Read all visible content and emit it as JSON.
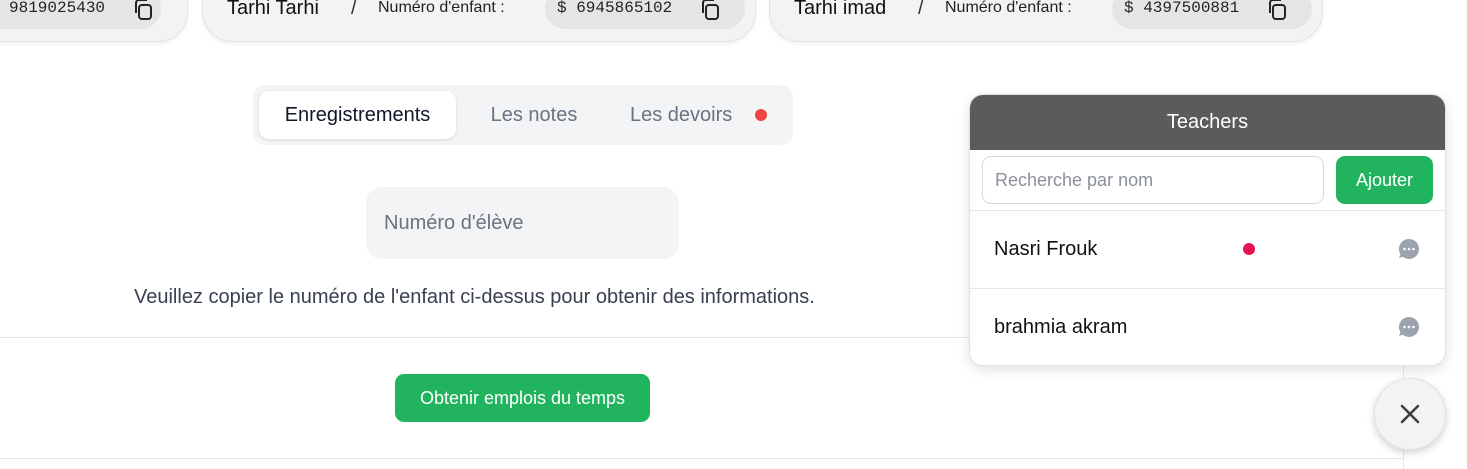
{
  "children": [
    {
      "name": "",
      "slash": "",
      "number_label": "",
      "number": "9819025430"
    },
    {
      "name": "Tarhi  Tarhi",
      "slash": "/",
      "number_label": "Numéro d'enfant :",
      "number": "$ 6945865102"
    },
    {
      "name": "Tarhi  imad",
      "slash": "/",
      "number_label": "Numéro d'enfant :",
      "number": "$ 4397500881"
    }
  ],
  "tabs": [
    {
      "label": "Enregistrements",
      "active": true
    },
    {
      "label": "Les notes",
      "active": false
    },
    {
      "label": "Les devoirs",
      "active": false,
      "badge": true
    }
  ],
  "student_input": {
    "placeholder": "Numéro d'élève"
  },
  "info_text": "Veuillez copier le numéro de l'enfant ci-dessus pour obtenir des informations.",
  "timetable_button": "Obtenir emplois du temps",
  "teachers_panel": {
    "title": "Teachers",
    "search_placeholder": "Recherche par nom",
    "add_button": "Ajouter",
    "teachers": [
      {
        "name": "Nasri Frouk",
        "unread": true,
        "icon": "chat-icon"
      },
      {
        "name": "brahmia akram",
        "unread": false,
        "icon": "chat-icon"
      }
    ]
  },
  "icons": {
    "copy": "copy-icon",
    "chat": "chat-bubble-icon",
    "close": "close-icon"
  },
  "colors": {
    "accent": "#22b35e",
    "badge_red": "#ef4444",
    "unread_pink": "#e8114f",
    "panel_header": "#5b5b5b"
  }
}
